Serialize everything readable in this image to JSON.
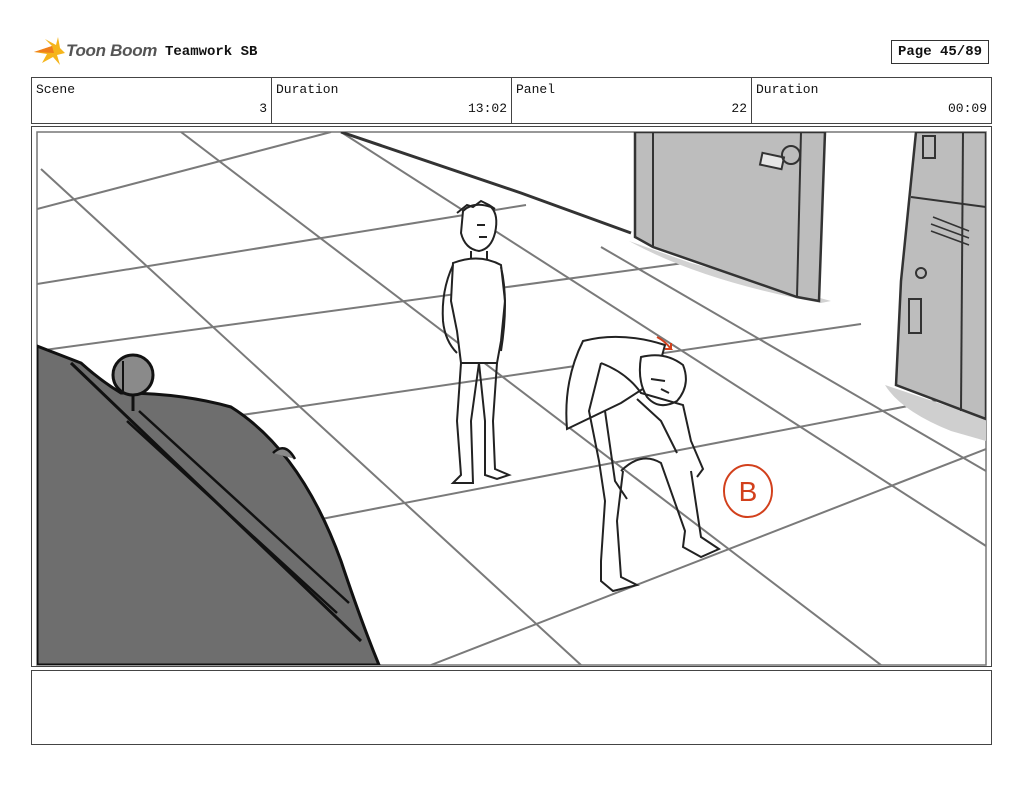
{
  "header": {
    "logo_text": "Toon Boom",
    "project_title": "Teamwork SB",
    "page_label": "Page 45/89"
  },
  "info": [
    {
      "label": "Scene",
      "value": "3"
    },
    {
      "label": "Duration",
      "value": "13:02"
    },
    {
      "label": "Panel",
      "value": "22"
    },
    {
      "label": "Duration",
      "value": "00:09"
    }
  ],
  "panel": {
    "annotation_letter": "B",
    "annotation_color": "#d2401c"
  },
  "notes": {
    "text": ""
  }
}
